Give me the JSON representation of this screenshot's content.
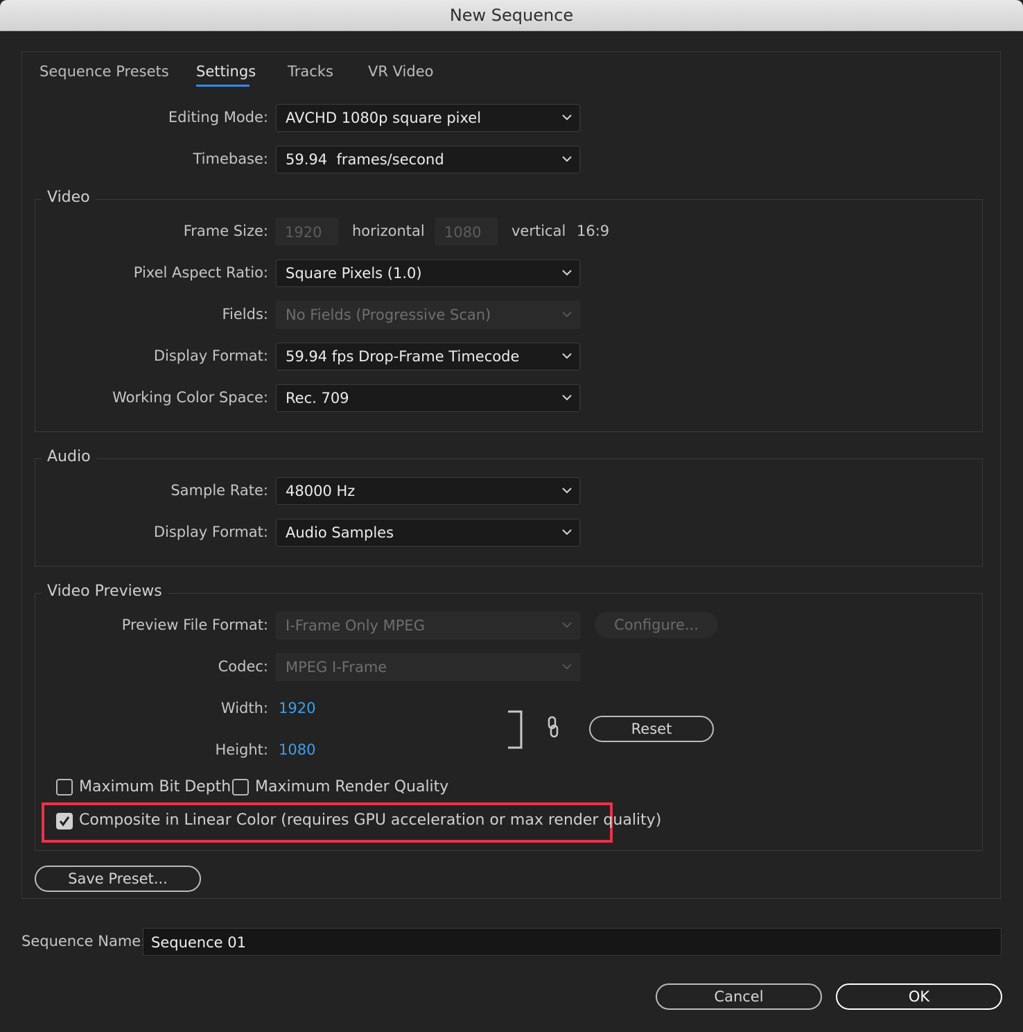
{
  "window": {
    "title": "New Sequence"
  },
  "tabs": [
    {
      "label": "Sequence Presets",
      "active": false
    },
    {
      "label": "Settings",
      "active": true
    },
    {
      "label": "Tracks",
      "active": false
    },
    {
      "label": "VR Video",
      "active": false
    }
  ],
  "general": {
    "editing_mode": {
      "label": "Editing Mode:",
      "value": "AVCHD 1080p square pixel"
    },
    "timebase": {
      "label": "Timebase:",
      "value": "59.94  frames/second"
    }
  },
  "video": {
    "title": "Video",
    "frame_size": {
      "label": "Frame Size:",
      "horizontal": "1920",
      "horizontal_label": "horizontal",
      "vertical": "1080",
      "vertical_label": "vertical",
      "aspect": "16:9"
    },
    "pixel_aspect_ratio": {
      "label": "Pixel Aspect Ratio:",
      "value": "Square Pixels (1.0)"
    },
    "fields": {
      "label": "Fields:",
      "value": "No Fields (Progressive Scan)",
      "disabled": true
    },
    "display_format": {
      "label": "Display Format:",
      "value": "59.94 fps Drop-Frame Timecode"
    },
    "working_color_space": {
      "label": "Working Color Space:",
      "value": "Rec. 709"
    }
  },
  "audio": {
    "title": "Audio",
    "sample_rate": {
      "label": "Sample Rate:",
      "value": "48000 Hz"
    },
    "display_format": {
      "label": "Display Format:",
      "value": "Audio Samples"
    }
  },
  "video_previews": {
    "title": "Video Previews",
    "preview_file_format": {
      "label": "Preview File Format:",
      "value": "I-Frame Only MPEG",
      "disabled": true
    },
    "configure_label": "Configure...",
    "codec": {
      "label": "Codec:",
      "value": "MPEG I-Frame",
      "disabled": true
    },
    "width": {
      "label": "Width:",
      "value": "1920"
    },
    "height": {
      "label": "Height:",
      "value": "1080"
    },
    "reset_label": "Reset",
    "max_bit_depth": {
      "label": "Maximum Bit Depth",
      "checked": false
    },
    "max_render_quality": {
      "label": "Maximum Render Quality",
      "checked": false
    },
    "composite_linear": {
      "label": "Composite in Linear Color (requires GPU acceleration or max render quality)",
      "checked": true
    }
  },
  "save_preset_label": "Save Preset...",
  "sequence_name": {
    "label": "Sequence Name:",
    "value": "Sequence 01"
  },
  "buttons": {
    "cancel": "Cancel",
    "ok": "OK"
  },
  "colors": {
    "background": "#232323",
    "accent": "#2d8ceb",
    "link": "#3a9ff0",
    "highlight": "#e8334a"
  }
}
